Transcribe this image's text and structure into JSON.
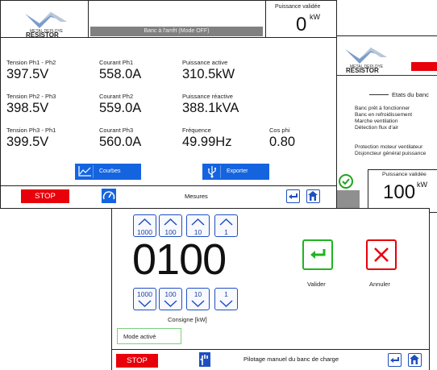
{
  "brand": {
    "line1": "METAL DEPLOYE",
    "line2": "RESISTOR"
  },
  "status_panel": {
    "title": "Etats du banc",
    "states": [
      "Banc prêt à fonctionner",
      "Banc en refroidissement",
      "Marche ventilation",
      "Détection flux d'air",
      "Protection moteur ventilateur",
      "Disjoncteur général puissance"
    ],
    "power_label": "Puissance validée",
    "power_value": "100",
    "power_unit": "kW"
  },
  "manual_panel": {
    "up_buttons": [
      "1000",
      "100",
      "10",
      "1"
    ],
    "down_buttons": [
      "1000",
      "100",
      "10",
      "1"
    ],
    "setpoint": "0100",
    "setpoint_label": "Consigne  [kW]",
    "mode_text": "Mode activé",
    "validate_label": "Valider",
    "cancel_label": "Annuler",
    "stop_label": "STOP",
    "footer_title": "Pilotage manuel du banc de charge"
  },
  "measure_panel": {
    "state_text": "Banc à l'arrêt (Mode OFF)",
    "power_label": "Puissance validée",
    "power_value": "0",
    "power_unit": "kW",
    "rows": [
      [
        {
          "label": "Tension Ph1 - Ph2",
          "value": "397.5V"
        },
        {
          "label": "Courant Ph1",
          "value": "558.0A"
        },
        {
          "label": "Puissance active",
          "value": "310.5kW"
        }
      ],
      [
        {
          "label": "Tension Ph2 - Ph3",
          "value": "398.5V"
        },
        {
          "label": "Courant Ph2",
          "value": "559.0A"
        },
        {
          "label": "Puissance réactive",
          "value": "388.1kVA"
        }
      ],
      [
        {
          "label": "Tension Ph3 - Ph1",
          "value": "399.5V"
        },
        {
          "label": "Courant Ph3",
          "value": "560.0A"
        },
        {
          "label": "Fréquence",
          "value": "49.99Hz"
        },
        {
          "label": "Cos phi",
          "value": "0.80"
        }
      ]
    ],
    "curves_label": "Courbes",
    "export_label": "Exporter",
    "stop_label": "STOP",
    "footer_title": "Mesures"
  },
  "colors": {
    "stop_red": "#e8000b",
    "accent_blue": "#1464e0",
    "validate_green": "#1fb51f",
    "cancel_red": "#e8000b"
  }
}
